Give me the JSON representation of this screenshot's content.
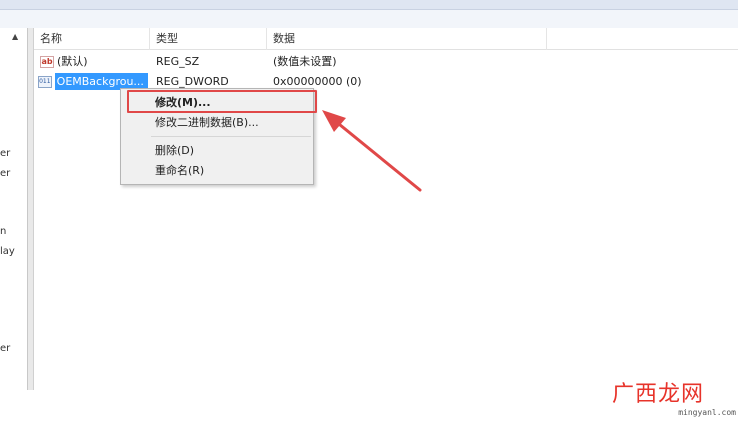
{
  "columns": {
    "name": "名称",
    "type": "类型",
    "data": "数据"
  },
  "rows": [
    {
      "icon": "string-value-icon",
      "name": "(默认)",
      "type": "REG_SZ",
      "data": "(数值未设置)"
    },
    {
      "icon": "binary-value-icon",
      "name": "OEMBackgrou...",
      "type": "REG_DWORD",
      "data": "0x00000000 (0)"
    }
  ],
  "left_fragments": [
    "er",
    "er",
    "n",
    "lay",
    "er"
  ],
  "context_menu": {
    "modify": "修改(M)...",
    "modify_binary": "修改二进制数据(B)...",
    "delete": "删除(D)",
    "rename": "重命名(R)"
  },
  "watermark": {
    "text": "广西龙网",
    "url": "mingyanl.com"
  },
  "colors": {
    "selection": "#3399ff",
    "highlight": "#e04848",
    "watermark": "#e7332a"
  }
}
